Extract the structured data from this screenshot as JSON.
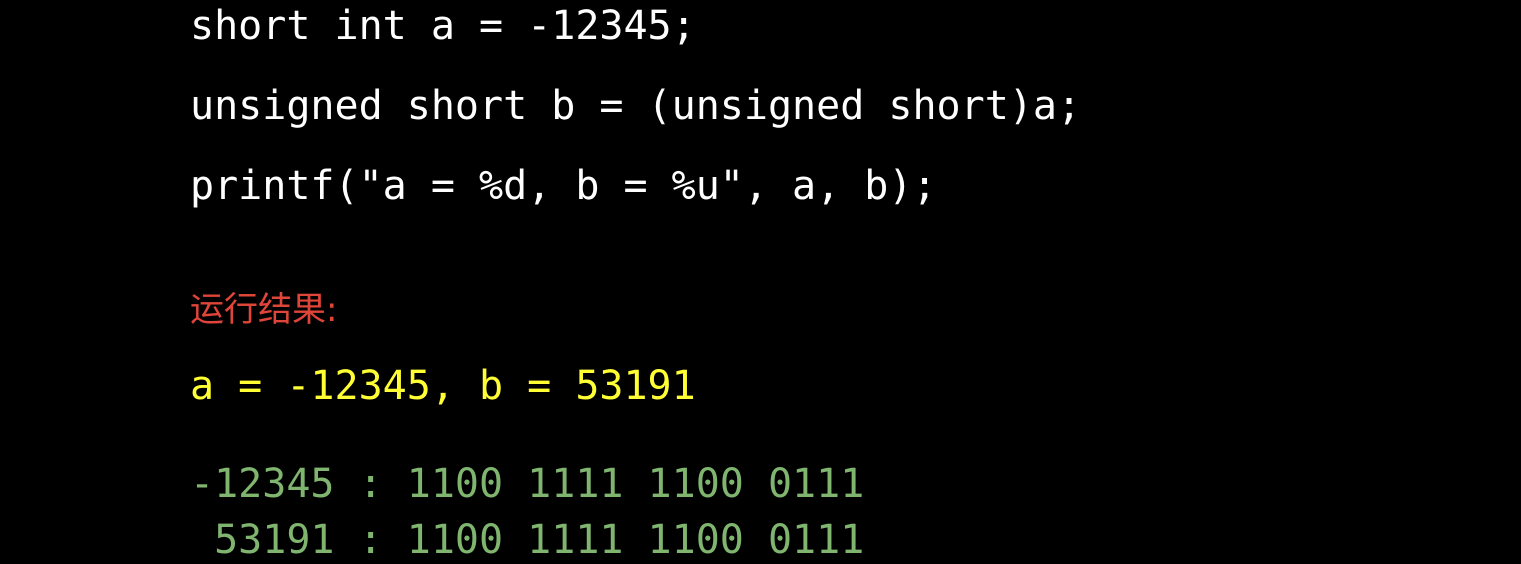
{
  "code_lines": [
    "short int a = -12345;",
    "unsigned short b = (unsigned short)a;",
    "printf(\"a = %d, b = %u\", a, b);"
  ],
  "result_label": "运行结果:",
  "output_line": "a = -12345, b = 53191",
  "binary_lines": [
    "-12345 : 1100 1111 1100 0111",
    " 53191 : 1100 1111 1100 0111"
  ],
  "colors": {
    "background": "#000000",
    "code": "#ffffff",
    "result_label": "#e0453a",
    "output": "#ffff33",
    "binary": "#7fb56f"
  }
}
